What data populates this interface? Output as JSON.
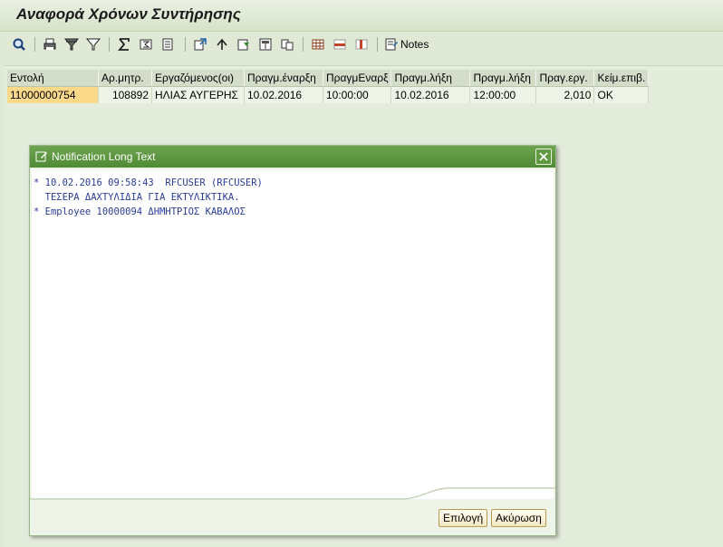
{
  "window": {
    "title": "Αναφορά Χρόνων Συντήρησης"
  },
  "toolbar": {
    "icons": [
      "magnifier-icon",
      "print-icon",
      "filter-icon",
      "filter-set-icon",
      "sum-icon",
      "subtotal-icon",
      "layout-icon",
      "export-icon",
      "sort-icon",
      "select-layout-icon",
      "change-layout-icon",
      "info-icon",
      "grid-icon",
      "insert-row-icon",
      "delete-row-icon",
      "notes-icon"
    ],
    "notes_label": "Notes"
  },
  "table": {
    "columns": [
      "Εντολή",
      "Αρ.μητρ.",
      "Εργαζόμενος(οι)",
      "Πραγμ.έναρξη",
      "ΠραγμΕναρξ",
      "Πραγμ.λήξη",
      "Πραγμ.λήξη",
      "Πραγ.εργ.",
      "Κείμ.επιβ."
    ],
    "rows": [
      [
        "11000000754",
        "108892",
        "ΗΛΙΑΣ ΑΥΓΕΡΗΣ",
        "10.02.2016",
        "10:00:00",
        "10.02.2016",
        "12:00:00",
        "2,010",
        "OK"
      ]
    ]
  },
  "dialog": {
    "title": "Notification Long Text",
    "lines": [
      "* 10.02.2016 09:58:43  RFCUSER (RFCUSER)",
      "  ΤΕΣΕΡΑ ΔΑΧΤΥΛΙΔΙΑ ΓΙΑ ΕΚΤΥΛΙΚΤΙΚΑ.",
      "* Employee 10000094 ΔΗΜΗΤΡΙΟΣ ΚΑΒΑΛΟΣ"
    ],
    "ok_label": "Επιλογή",
    "cancel_label": "Ακύρωση"
  },
  "colors": {
    "background": "#dfe9d6",
    "dialog_header": "#5a9640",
    "selected_cell": "#fbd98a",
    "text_blue": "#2a3c9a"
  }
}
